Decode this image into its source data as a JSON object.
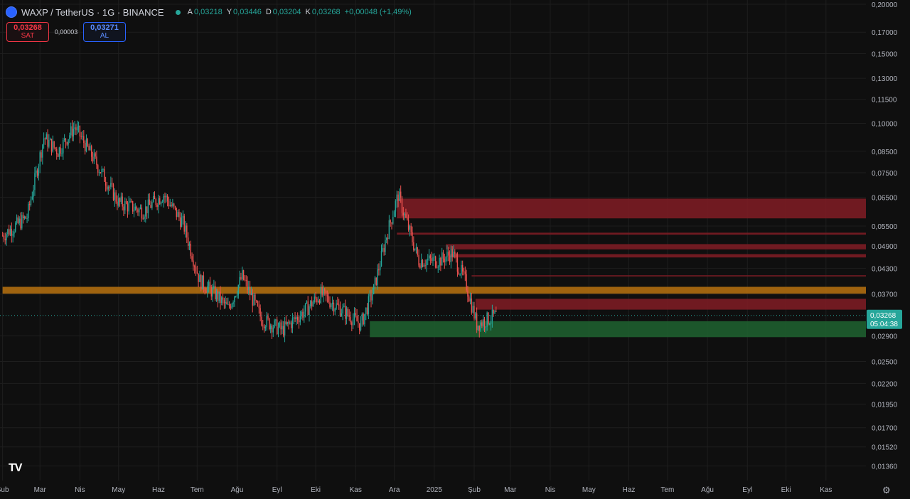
{
  "header": {
    "symbol": "WAXP / TetherUS · 1G · BINANCE",
    "ohlc": [
      {
        "k": "A",
        "v": "0,03218"
      },
      {
        "k": "Y",
        "v": "0,03446"
      },
      {
        "k": "D",
        "v": "0,03204"
      },
      {
        "k": "K",
        "v": "0,03268"
      }
    ],
    "change": "+0,00048 (+1,49%)"
  },
  "trade": {
    "sell_price": "0,03268",
    "sell_label": "SAT",
    "spread": "0,00003",
    "buy_price": "0,03271",
    "buy_label": "AL"
  },
  "logo_text": "TV",
  "colors": {
    "up": "#26a69a",
    "down": "#ef5350",
    "resistance_zone": "#7b1c24",
    "support_zone": "#1e5e2f",
    "key_level": "#b8720f",
    "background": "#0f0f0f",
    "grid": "#1e1e1e"
  },
  "chart_data": {
    "type": "candlestick",
    "y_scale": "log",
    "ylim": [
      0.0125,
      0.205
    ],
    "y_ticks": [
      "0,20000",
      "0,17000",
      "0,15000",
      "0,13000",
      "0,11500",
      "0,10000",
      "0,08500",
      "0,07500",
      "0,06500",
      "0,05500",
      "0,04900",
      "0,04300",
      "0,03700",
      "0,02900",
      "0,02500",
      "0,02200",
      "0,01950",
      "0,01700",
      "0,01520",
      "0,01360"
    ],
    "x_ticks": [
      "Şub",
      "Mar",
      "Nis",
      "May",
      "Haz",
      "Tem",
      "Ağu",
      "Eyl",
      "Eki",
      "Kas",
      "Ara",
      "2025",
      "Şub",
      "Mar",
      "Nis",
      "May",
      "Haz",
      "Tem",
      "Ağu",
      "Eyl",
      "Eki",
      "Kas"
    ],
    "last_price": {
      "value": 0.03268,
      "label": "0,03268",
      "countdown": "05:04:38"
    },
    "trend_anchors": [
      {
        "date": "2024-02-01",
        "price": 0.052
      },
      {
        "date": "2024-02-20",
        "price": 0.058
      },
      {
        "date": "2024-03-04",
        "price": 0.092
      },
      {
        "date": "2024-03-15",
        "price": 0.085
      },
      {
        "date": "2024-03-28",
        "price": 0.098
      },
      {
        "date": "2024-04-15",
        "price": 0.078
      },
      {
        "date": "2024-05-01",
        "price": 0.063
      },
      {
        "date": "2024-05-20",
        "price": 0.06
      },
      {
        "date": "2024-06-05",
        "price": 0.066
      },
      {
        "date": "2024-06-20",
        "price": 0.056
      },
      {
        "date": "2024-07-03",
        "price": 0.04
      },
      {
        "date": "2024-07-15",
        "price": 0.037
      },
      {
        "date": "2024-07-25",
        "price": 0.034
      },
      {
        "date": "2024-08-05",
        "price": 0.041
      },
      {
        "date": "2024-08-20",
        "price": 0.032
      },
      {
        "date": "2024-09-05",
        "price": 0.03
      },
      {
        "date": "2024-09-20",
        "price": 0.033
      },
      {
        "date": "2024-10-05",
        "price": 0.037
      },
      {
        "date": "2024-10-20",
        "price": 0.034
      },
      {
        "date": "2024-11-05",
        "price": 0.031
      },
      {
        "date": "2024-11-15",
        "price": 0.038
      },
      {
        "date": "2024-11-25",
        "price": 0.052
      },
      {
        "date": "2024-12-04",
        "price": 0.066
      },
      {
        "date": "2024-12-10",
        "price": 0.057
      },
      {
        "date": "2024-12-20",
        "price": 0.045
      },
      {
        "date": "2025-01-05",
        "price": 0.045
      },
      {
        "date": "2025-01-15",
        "price": 0.047
      },
      {
        "date": "2025-01-25",
        "price": 0.04
      },
      {
        "date": "2025-02-03",
        "price": 0.031
      },
      {
        "date": "2025-02-18",
        "price": 0.0327
      }
    ],
    "zones": [
      {
        "kind": "resistance",
        "low": 0.0575,
        "high": 0.0645,
        "from": "2024-12-03",
        "to": "2025-12-31"
      },
      {
        "kind": "resistance",
        "low": 0.0523,
        "high": 0.0529,
        "from": "2024-12-03",
        "to": "2025-12-31"
      },
      {
        "kind": "resistance",
        "low": 0.048,
        "high": 0.0495,
        "from": "2025-01-10",
        "to": "2025-12-31"
      },
      {
        "kind": "resistance",
        "low": 0.0458,
        "high": 0.0467,
        "from": "2025-01-13",
        "to": "2025-12-31"
      },
      {
        "kind": "resistance",
        "low": 0.041,
        "high": 0.0413,
        "from": "2025-01-30",
        "to": "2025-12-31"
      },
      {
        "kind": "resistance",
        "low": 0.0338,
        "high": 0.036,
        "from": "2025-02-02",
        "to": "2025-12-31"
      },
      {
        "kind": "support",
        "low": 0.0288,
        "high": 0.0316,
        "from": "2024-11-12",
        "to": "2025-12-31"
      },
      {
        "kind": "key_level",
        "low": 0.0371,
        "high": 0.0386,
        "from": "2024-02-01",
        "to": "2025-12-31"
      }
    ]
  }
}
